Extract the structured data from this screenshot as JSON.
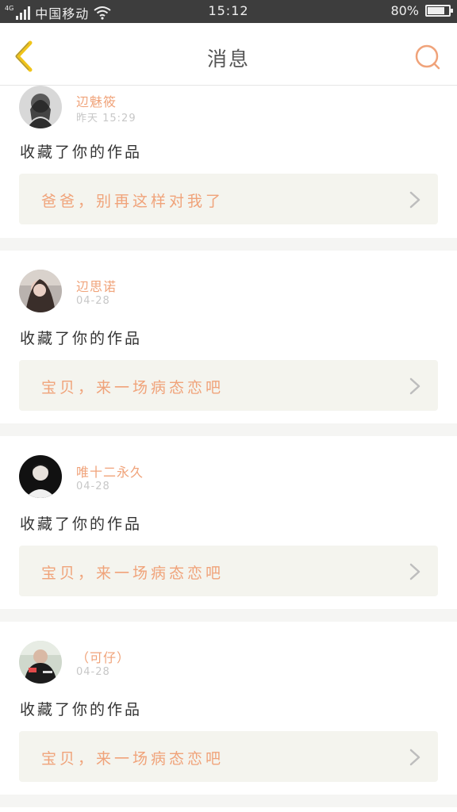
{
  "status_bar": {
    "network": "4G",
    "carrier": "中国移动",
    "time": "15:12",
    "battery_percent_label": "80%",
    "battery_level": 0.8,
    "icons": [
      "signal-icon",
      "wifi-icon",
      "battery-icon"
    ]
  },
  "header": {
    "title": "消息",
    "back_icon": "chevron-left-icon",
    "search_icon": "search-icon"
  },
  "colors": {
    "accent": "#f0a37a",
    "back_icon": "#f0c419",
    "quote_bg": "#f4f4ee",
    "page_bg": "#f5f5f3",
    "status_bar_bg": "#3d3d3d"
  },
  "messages": [
    {
      "username": "辺魅筱",
      "time": "昨天 15:29",
      "action": "收藏了你的作品",
      "work_title": "爸爸，别再这样对我了"
    },
    {
      "username": "辺思诺",
      "time": "04-28",
      "action": "收藏了你的作品",
      "work_title": "宝贝，来一场病态恋吧"
    },
    {
      "username": "唯十二永久",
      "time": "04-28",
      "action": "收藏了你的作品",
      "work_title": "宝贝，来一场病态恋吧"
    },
    {
      "username": "（可仔）",
      "time": "04-28",
      "action": "收藏了你的作品",
      "work_title": "宝贝，来一场病态恋吧"
    }
  ]
}
